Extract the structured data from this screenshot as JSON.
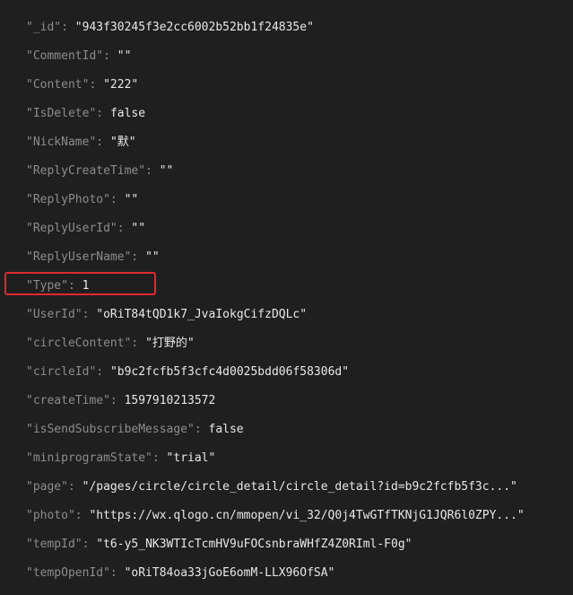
{
  "document": {
    "rows": [
      {
        "key": "\"_id\"",
        "value": "\"943f30245f3e2cc6002b52bb1f24835e\""
      },
      {
        "key": "\"CommentId\"",
        "value": "\"\""
      },
      {
        "key": "\"Content\"",
        "value": "\"222\""
      },
      {
        "key": "\"IsDelete\"",
        "value": "false"
      },
      {
        "key": "\"NickName\"",
        "value": "\"默\""
      },
      {
        "key": "\"ReplyCreateTime\"",
        "value": "\"\""
      },
      {
        "key": "\"ReplyPhoto\"",
        "value": "\"\""
      },
      {
        "key": "\"ReplyUserId\"",
        "value": "\"\""
      },
      {
        "key": "\"ReplyUserName\"",
        "value": "\"\""
      },
      {
        "key": "\"Type\"",
        "value": "1"
      },
      {
        "key": "\"UserId\"",
        "value": "\"oRiT84tQD1k7_JvaIokgCifzDQLc\""
      },
      {
        "key": "\"circleContent\"",
        "value": "\"打野的\""
      },
      {
        "key": "\"circleId\"",
        "value": "\"b9c2fcfb5f3cfc4d0025bdd06f58306d\""
      },
      {
        "key": "\"createTime\"",
        "value": "1597910213572"
      },
      {
        "key": "\"isSendSubscribeMessage\"",
        "value": "false"
      },
      {
        "key": "\"miniprogramState\"",
        "value": "\"trial\""
      },
      {
        "key": "\"page\"",
        "value": "\"/pages/circle/circle_detail/circle_detail?id=b9c2fcfb5f3c...\""
      },
      {
        "key": "\"photo\"",
        "value": "\"https://wx.qlogo.cn/mmopen/vi_32/Q0j4TwGTfTKNjG1JQR6l0ZPY...\""
      },
      {
        "key": "\"tempId\"",
        "value": "\"t6-y5_NK3WTIcTcmHV9uFOCsnbraWHfZ4Z0RIml-F0g\""
      },
      {
        "key": "\"tempOpenId\"",
        "value": "\"oRiT84oa33jGoE6omM-LLX96OfSA\""
      }
    ],
    "separator": ":"
  },
  "highlight": {
    "color": "#e0282e",
    "target_field": "\"Type\""
  }
}
